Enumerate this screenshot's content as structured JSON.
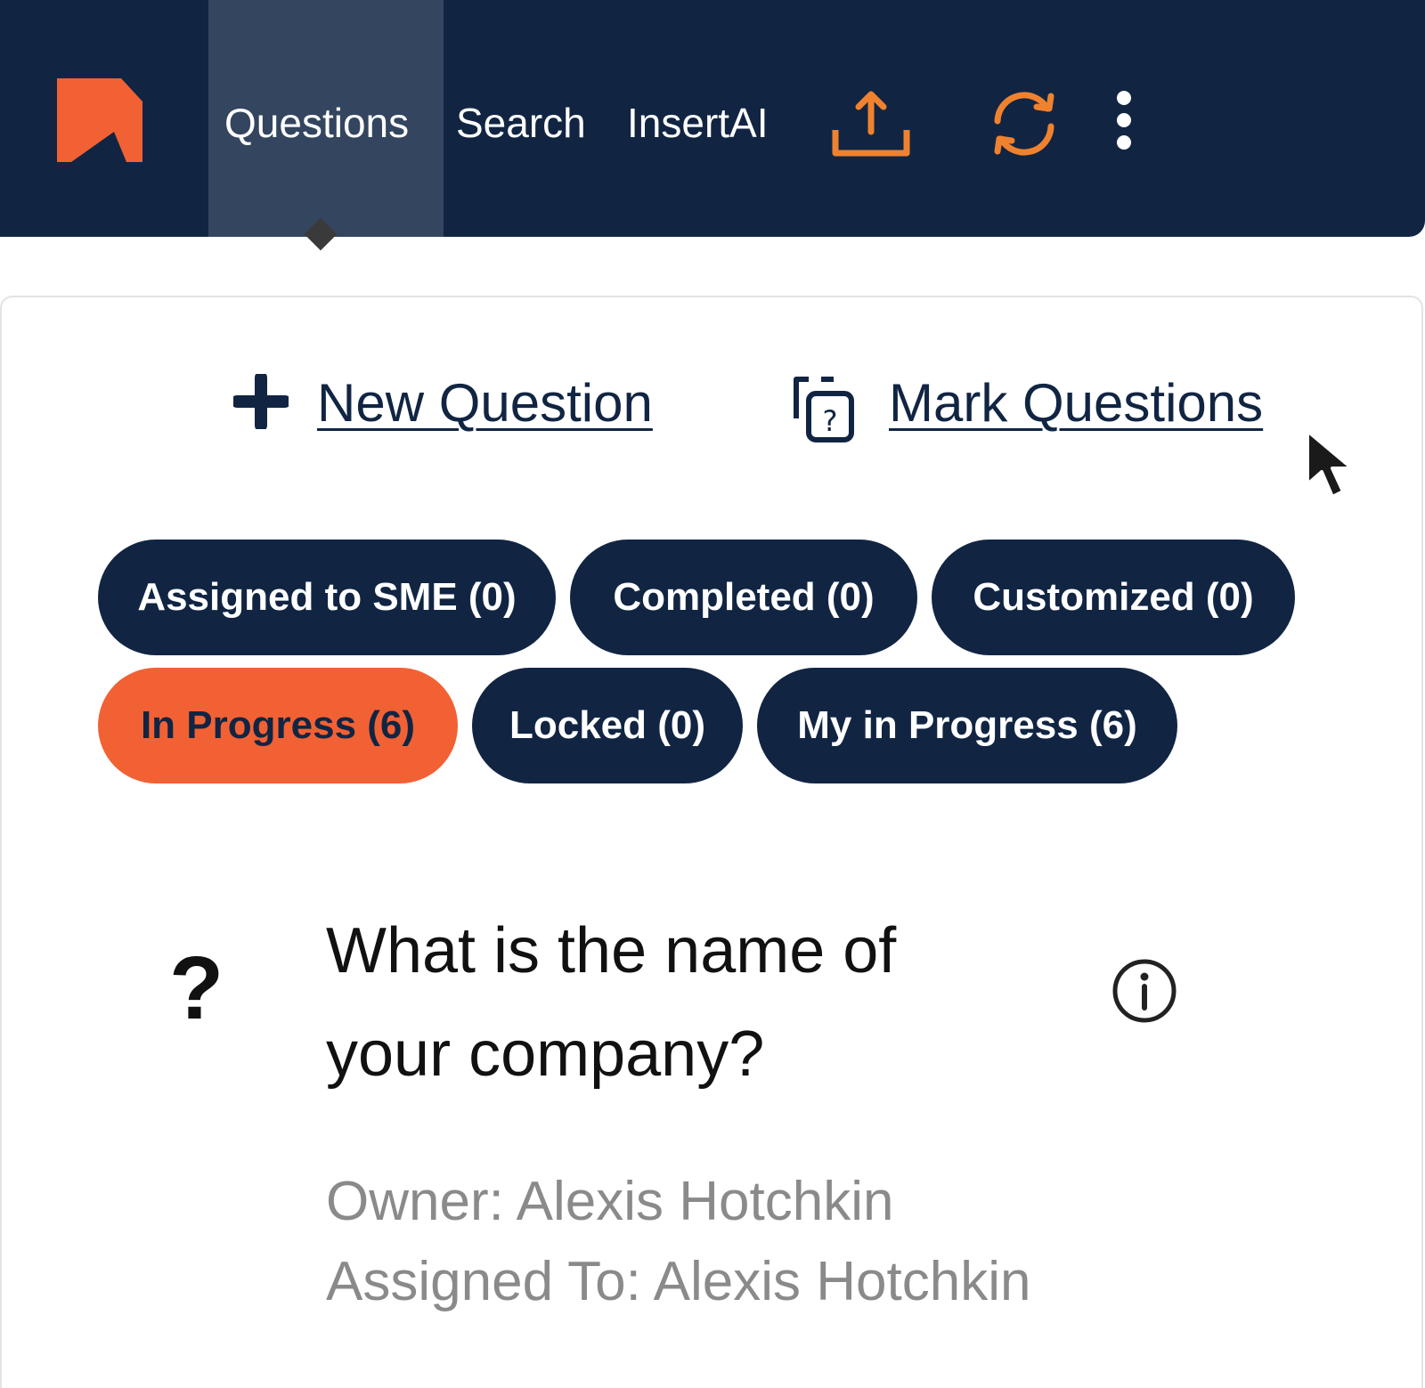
{
  "nav": {
    "tabs": [
      {
        "label": "Questions",
        "active": true
      },
      {
        "label": "Search",
        "active": false
      },
      {
        "label": "InsertAI",
        "active": false
      }
    ],
    "icons": [
      "logo-icon",
      "upload-icon",
      "sync-icon",
      "more-vertical-icon"
    ]
  },
  "actions": {
    "new_question": "New Question",
    "mark_questions": "Mark Questions"
  },
  "filters": [
    {
      "label": "Assigned to SME (0)",
      "active": false
    },
    {
      "label": "Completed (0)",
      "active": false
    },
    {
      "label": "Customized (0)",
      "active": false
    },
    {
      "label": "In Progress (6)",
      "active": true
    },
    {
      "label": "Locked (0)",
      "active": false
    },
    {
      "label": "My in Progress (6)",
      "active": false
    }
  ],
  "question": {
    "marker": "?",
    "text": "What is the name of your company?",
    "owner": "Owner: Alexis Hotchkin",
    "assigned_to": "Assigned To: Alexis Hotchkin"
  },
  "colors": {
    "navy": "#112543",
    "active_tab": "#34455f",
    "accent_orange": "#f26134",
    "icon_orange": "#f0822f",
    "meta_gray": "#8a8a8a"
  }
}
